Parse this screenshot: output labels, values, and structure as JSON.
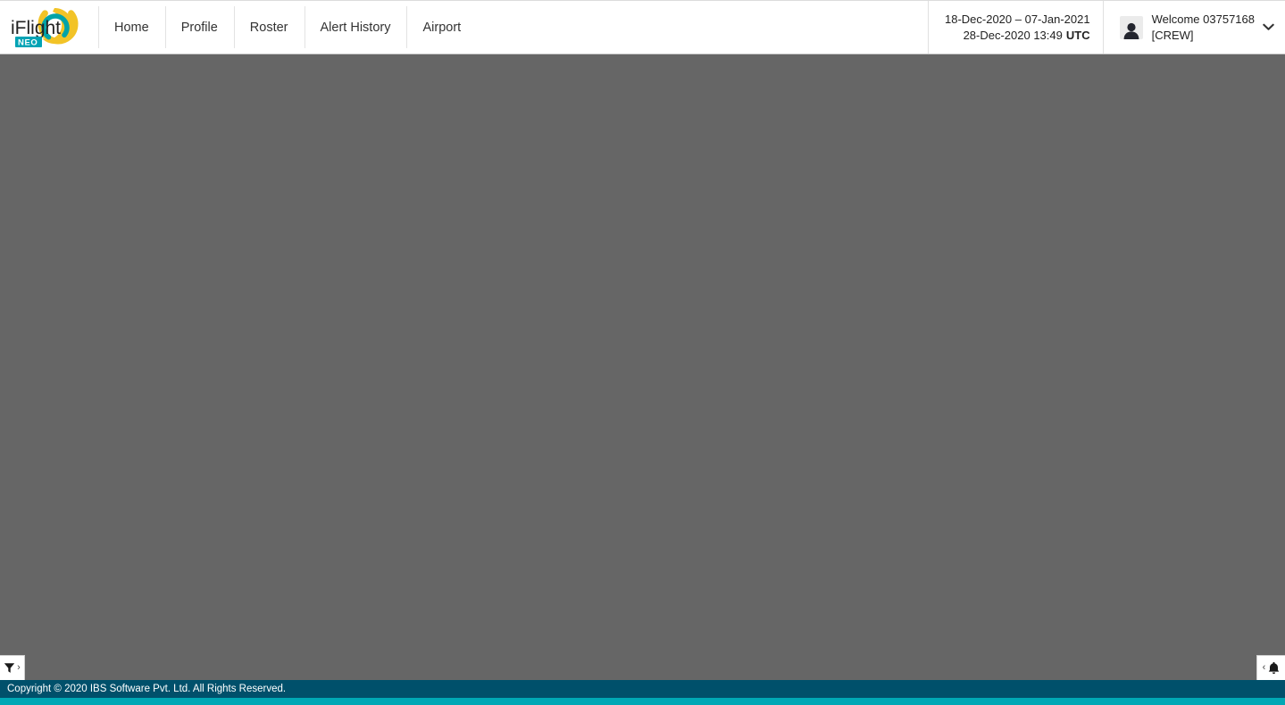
{
  "brand": {
    "name": "iFlight",
    "sub": "NEO",
    "colors": {
      "arc_outer": "#F2C327",
      "arc_inner": "#00A3A8",
      "badge": "#00A3B5",
      "wordmark": "#222222"
    }
  },
  "nav": {
    "items": [
      {
        "label": "Home",
        "name": "nav-item-home"
      },
      {
        "label": "Profile",
        "name": "nav-item-profile"
      },
      {
        "label": "Roster",
        "name": "nav-item-roster"
      },
      {
        "label": "Alert History",
        "name": "nav-item-alert-history"
      },
      {
        "label": "Airport",
        "name": "nav-item-airport"
      }
    ]
  },
  "datetime": {
    "range": "18-Dec-2020 – 07-Jan-2021",
    "stamp": "28-Dec-2020 13:49",
    "timezone": "UTC"
  },
  "user": {
    "welcome": "Welcome 03757168",
    "role": "[CREW]",
    "avatar_icon": "user-avatar-icon",
    "chevron_icon": "chevron-down-icon"
  },
  "main": {
    "background_color": "#666666",
    "filter_tab": {
      "icon": "filter-funnel-icon",
      "chevron": "chevron-right-icon"
    },
    "notification_tab": {
      "icon": "bell-icon",
      "chevron": "chevron-left-icon"
    }
  },
  "footer": {
    "copyright": "Copyright © 2020 IBS Software Pvt. Ltd. All Rights Reserved.",
    "bar_color": "#00506b",
    "strip_color": "#00a8b5"
  }
}
